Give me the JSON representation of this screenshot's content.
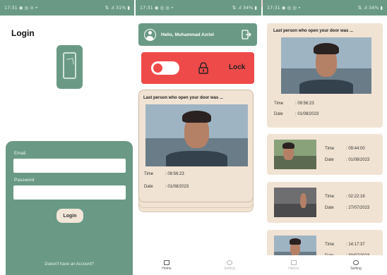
{
  "status_bar": {
    "left": [
      "17:31 ◉ ◎ ⊙ •",
      "17:31 ◉ ◎ ◎ •",
      "17:31 ◉ ◎ ◎ •"
    ],
    "right": [
      "⇅ .ıl 31% ▮",
      "⇅ .ıl 34% ▮",
      "⇅ .ıl 34% ▮"
    ]
  },
  "colors": {
    "primary": "#6a9a86",
    "card": "#f1e3d3",
    "lock_red": "#ef4a4a"
  },
  "login": {
    "title": "Login",
    "email_label": "Email",
    "email_value": "",
    "password_label": "Password",
    "password_value": "",
    "button": "Login",
    "signup_link": "Doesn't have an Account?"
  },
  "home": {
    "greeting": "Hello, Muhammad Azriel",
    "lock_label": "Lock",
    "lock_on": false,
    "last_title": "Last person who open your door was ...",
    "time_label": "Time",
    "time_value": ": 09:56:23",
    "date_label": "Date",
    "date_value": ": 01/08/2023"
  },
  "history": {
    "top": {
      "title": "Last person who open your door was ...",
      "time": "09:56:23",
      "date": "01/08/2023"
    },
    "entries": [
      {
        "time": "09:44:00",
        "date": "01/08/2023"
      },
      {
        "time": "02:22:16",
        "date": "27/07/2023"
      },
      {
        "time": "14:17:37",
        "date": "30/07/2023"
      }
    ],
    "time_label": "Time",
    "date_label": "Date",
    "sep": ":"
  },
  "nav": {
    "home": [
      "Home",
      "Setting"
    ],
    "history": [
      "History",
      "Setting"
    ]
  }
}
